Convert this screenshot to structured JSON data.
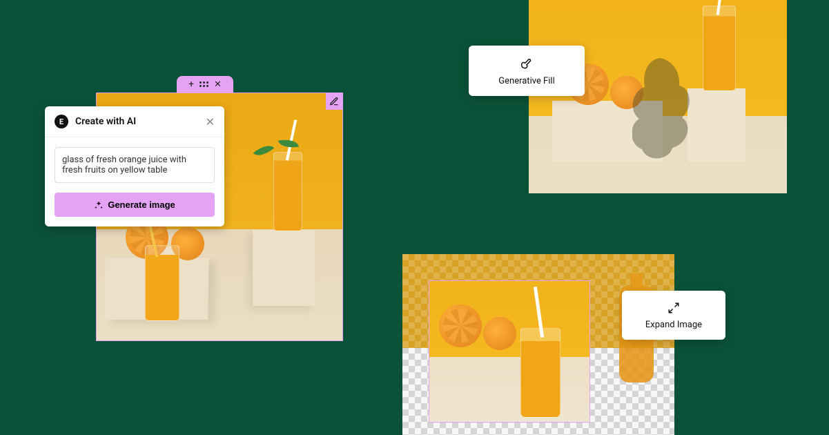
{
  "create_ai": {
    "title": "Create with AI",
    "prompt": "glass of fresh orange juice with fresh fruits on yellow table",
    "button": "Generate image"
  },
  "genfill": {
    "label": "Generative Fill"
  },
  "expand": {
    "label": "Expand Image"
  }
}
